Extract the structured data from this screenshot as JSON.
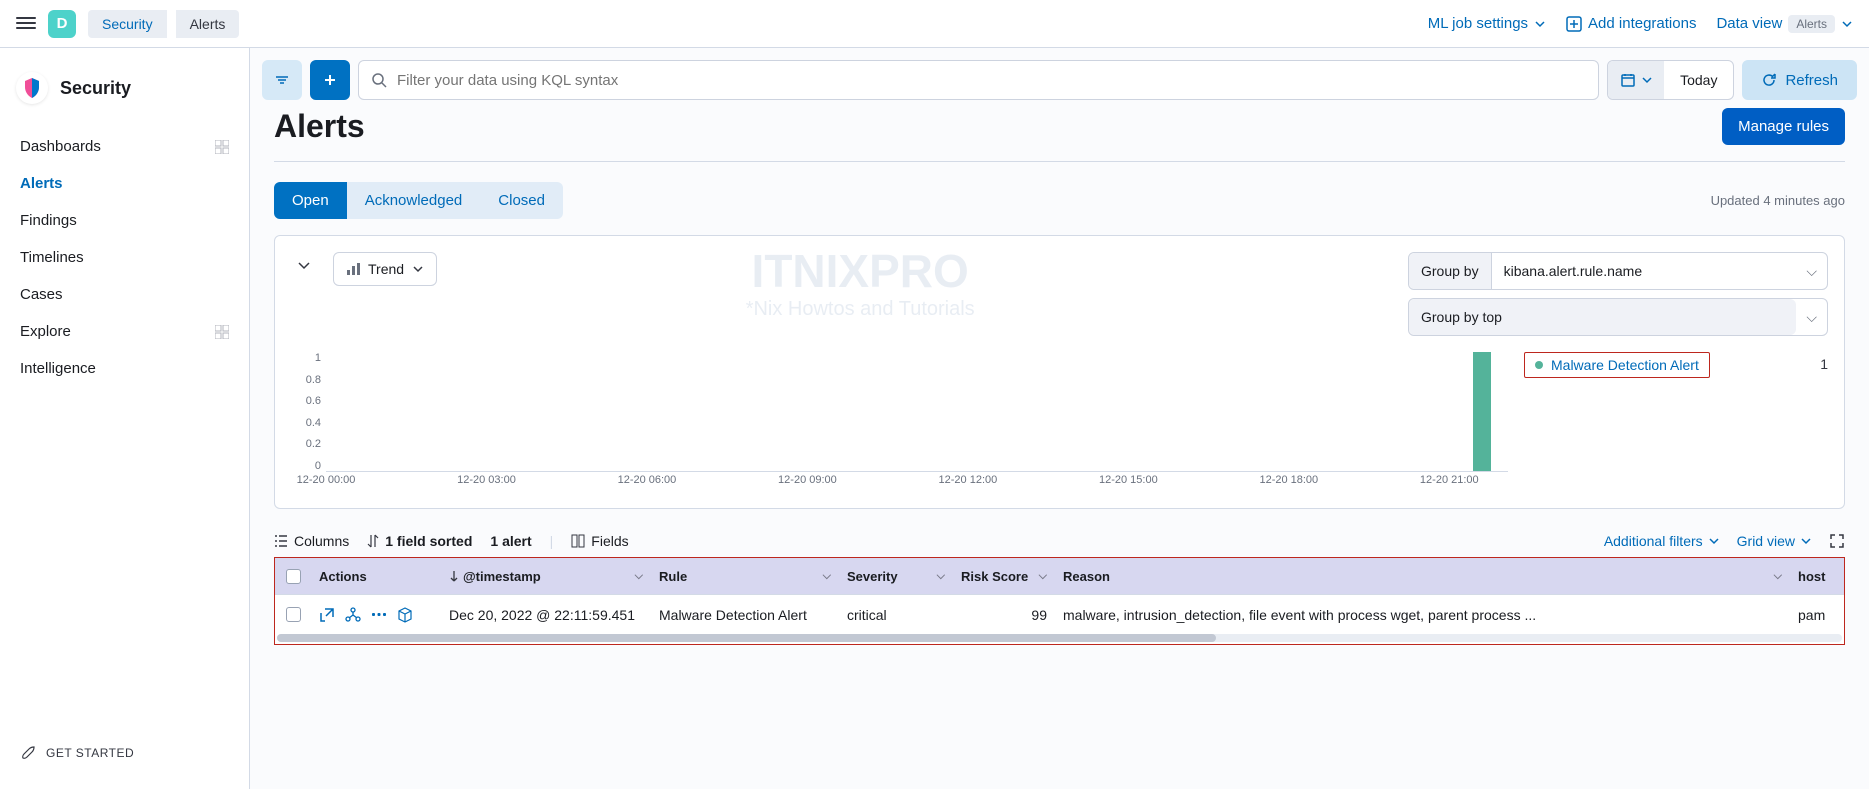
{
  "breadcrumb": {
    "root": "Security",
    "current": "Alerts"
  },
  "space_initial": "D",
  "topbar": {
    "ml": "ML job settings",
    "add": "Add integrations",
    "dv": "Data view",
    "dv_badge": "Alerts"
  },
  "app": {
    "title": "Security"
  },
  "nav": {
    "dashboards": "Dashboards",
    "alerts": "Alerts",
    "findings": "Findings",
    "timelines": "Timelines",
    "cases": "Cases",
    "explore": "Explore",
    "intelligence": "Intelligence"
  },
  "get_started": "GET STARTED",
  "search": {
    "placeholder": "Filter your data using KQL syntax"
  },
  "datepicker": {
    "label": "Today"
  },
  "refresh": "Refresh",
  "page": {
    "title": "Alerts",
    "manage": "Manage rules"
  },
  "status_tabs": {
    "open": "Open",
    "ack": "Acknowledged",
    "closed": "Closed"
  },
  "updated": "Updated 4 minutes ago",
  "trend": {
    "label": "Trend"
  },
  "group_by": {
    "label": "Group by",
    "value": "kibana.alert.rule.name"
  },
  "group_by_top": {
    "label": "Group by top"
  },
  "legend": {
    "item": "Malware Detection Alert",
    "count": "1"
  },
  "watermark": {
    "title": "ITNIXPRO",
    "sub": "*Nix Howtos and Tutorials"
  },
  "chart_data": {
    "type": "bar",
    "y_ticks": [
      "1",
      "0.8",
      "0.6",
      "0.4",
      "0.2",
      "0"
    ],
    "x_ticks": [
      "12-20 00:00",
      "12-20 03:00",
      "12-20 06:00",
      "12-20 09:00",
      "12-20 12:00",
      "12-20 15:00",
      "12-20 18:00",
      "12-20 21:00"
    ],
    "series": [
      {
        "name": "Malware Detection Alert",
        "values": [
          0,
          0,
          0,
          0,
          0,
          0,
          0,
          1
        ]
      }
    ],
    "ylim": [
      0,
      1
    ]
  },
  "toolbar": {
    "columns": "Columns",
    "sorted": "1 field sorted",
    "count": "1 alert",
    "fields": "Fields",
    "add_filters": "Additional filters",
    "grid": "Grid view"
  },
  "table": {
    "headers": {
      "actions": "Actions",
      "timestamp": "@timestamp",
      "rule": "Rule",
      "severity": "Severity",
      "risk": "Risk Score",
      "reason": "Reason",
      "host": "host"
    },
    "row": {
      "timestamp": "Dec 20, 2022 @ 22:11:59.451",
      "rule": "Malware Detection Alert",
      "severity": "critical",
      "risk": "99",
      "reason": "malware, intrusion_detection, file event with process wget, parent process ...",
      "host": "pam"
    }
  }
}
